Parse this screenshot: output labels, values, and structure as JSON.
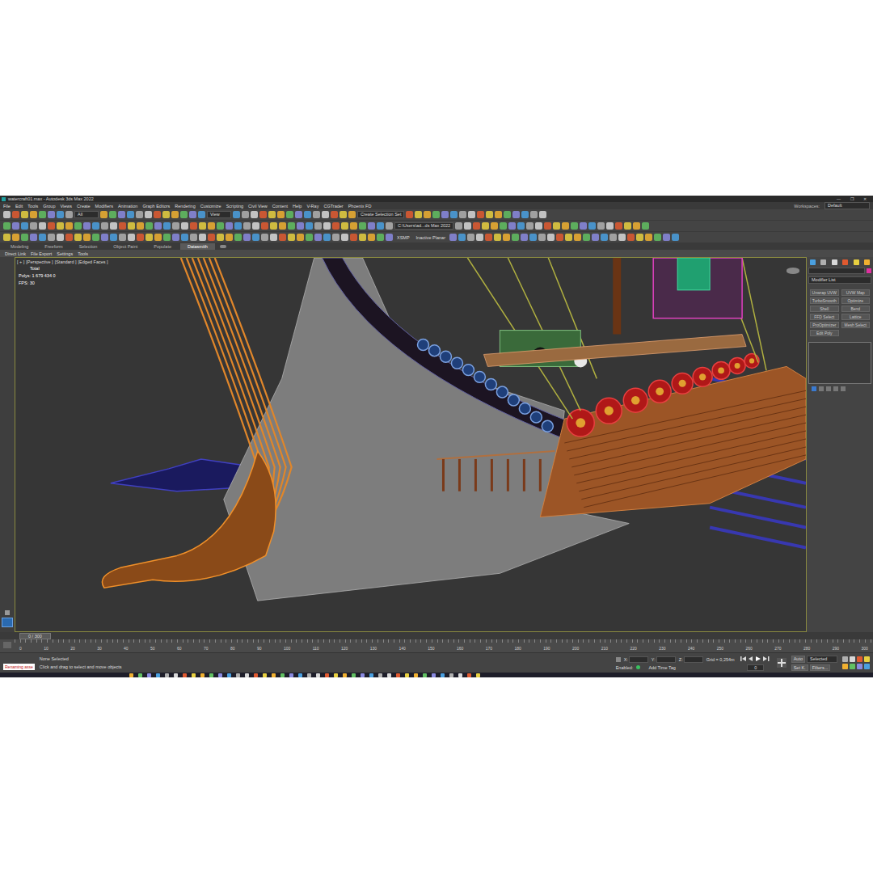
{
  "window": {
    "title": "watercraft01.max - Autodesk 3ds Max 2022",
    "controls": [
      "—",
      "❐",
      "✕"
    ]
  },
  "menu": [
    "File",
    "Edit",
    "Tools",
    "Group",
    "Views",
    "Create",
    "Modifiers",
    "Animation",
    "Graph Editors",
    "Rendering",
    "Customize",
    "Scripting",
    "Civil View",
    "Content",
    "Help",
    "V-Ray",
    "CGTrader",
    "Phoenix FD"
  ],
  "workspace": {
    "label": "Workspaces:",
    "value": "Default"
  },
  "toolbar": {
    "filter": "All",
    "view": "View",
    "selection_set": "Create Selection Set",
    "project": "C:\\Users\\ad...ds Max 2022",
    "xsmp": "XSMP",
    "planar": "Inactive Planar"
  },
  "ribbon": {
    "tabs": [
      {
        "label": "Modeling",
        "selected": false
      },
      {
        "label": "Freeform",
        "selected": false
      },
      {
        "label": "Selection",
        "selected": false
      },
      {
        "label": "Object Paint",
        "selected": false
      },
      {
        "label": "Populate",
        "selected": false
      },
      {
        "label": "Datasmith",
        "selected": true
      }
    ],
    "items": [
      "Direct Link",
      "File Export",
      "Settings",
      "Tools"
    ]
  },
  "viewport": {
    "labels": [
      "[ + ]",
      "[Perspective ]",
      "[Standard ]",
      "[Edged Faces ]"
    ],
    "stats": [
      "Total",
      "Polys:  1 679 434   0",
      "FPS:   30"
    ]
  },
  "command_panel": {
    "modifier_list": "Modifier List",
    "buttons": [
      "Unwrap UVW",
      "UVW Map",
      "TurboSmooth",
      "Optimize",
      "Shell",
      "Bend",
      "FFD Select",
      "Lattice",
      "ProOptimizer",
      "Mesh Select",
      "Edit Poly"
    ]
  },
  "timeline": {
    "frame": "0 / 300",
    "ticks": [
      "0",
      "10",
      "20",
      "30",
      "40",
      "50",
      "60",
      "70",
      "80",
      "90",
      "100",
      "110",
      "120",
      "130",
      "140",
      "150",
      "160",
      "170",
      "180",
      "190",
      "200",
      "210",
      "220",
      "230",
      "240",
      "250",
      "260",
      "270",
      "280",
      "290",
      "300"
    ]
  },
  "status": {
    "script": "Renaming asse",
    "selection": "None Selected",
    "prompt": "Click and drag to select and move objects",
    "x": "X:",
    "y": "Y:",
    "z": "Z:",
    "grid": "Grid = 0,254m",
    "enabled": "Enabled:",
    "time_tag": "Add Time Tag",
    "auto": "Auto",
    "selected": "Selected",
    "set_key": "Set K.",
    "filters": "Filters...",
    "frame": "0"
  }
}
